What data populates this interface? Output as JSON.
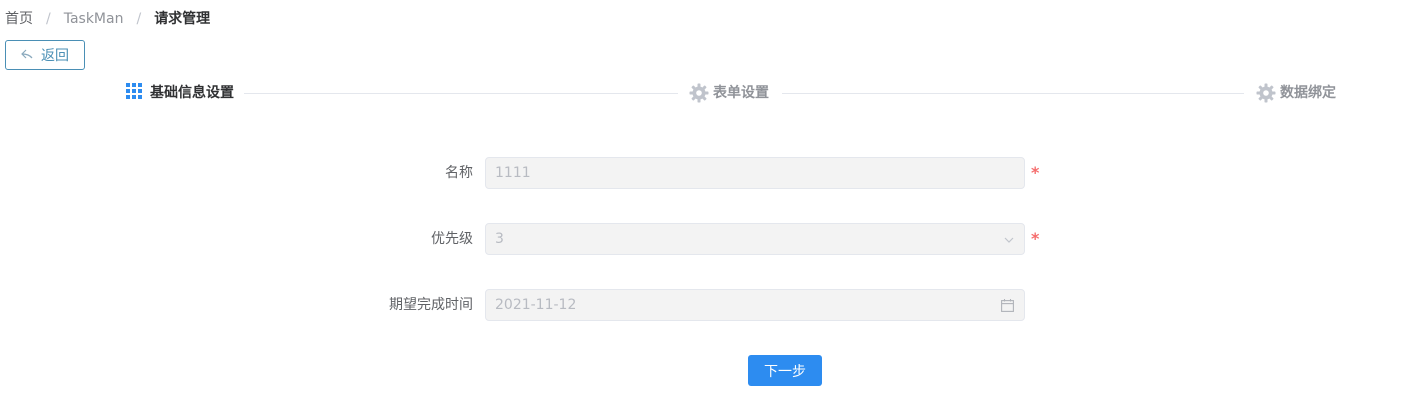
{
  "breadcrumb": {
    "home": "首页",
    "app": "TaskMan",
    "current": "请求管理"
  },
  "back_button": {
    "label": "返回",
    "icon": "back-arrow-icon"
  },
  "steps": [
    {
      "label": "基础信息设置",
      "icon": "grid-icon",
      "state": "active"
    },
    {
      "label": "表单设置",
      "icon": "gear-icon",
      "state": "inactive"
    },
    {
      "label": "数据绑定",
      "icon": "gear-icon",
      "state": "inactive"
    }
  ],
  "form": {
    "name": {
      "label": "名称",
      "value": "1111",
      "required": "*"
    },
    "priority": {
      "label": "优先级",
      "value": "3",
      "required": "*"
    },
    "expected_time": {
      "label": "期望完成时间",
      "value": "2021-11-12"
    }
  },
  "next_button": {
    "label": "下一步"
  },
  "colors": {
    "primary": "#2d8cf0",
    "required": "#f56c6c",
    "active_step_icon": "#2d8cf0"
  }
}
